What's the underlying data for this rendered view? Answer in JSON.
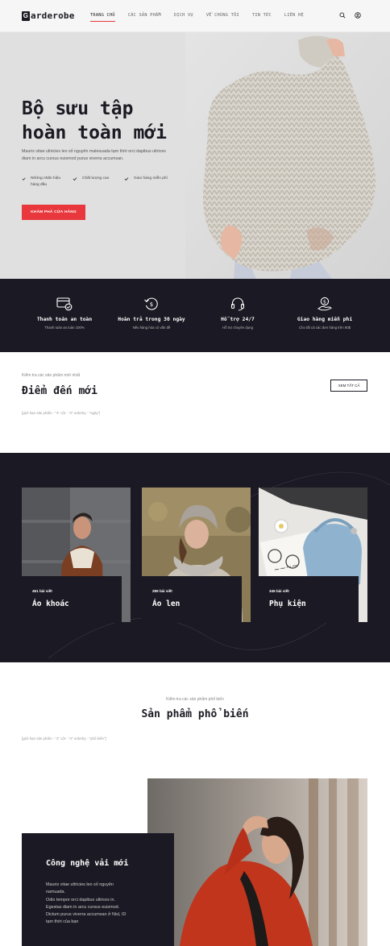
{
  "header": {
    "logo_letter": "G",
    "logo_text": "arderobe",
    "nav": [
      "TRANG CHỦ",
      "CÁC SẢN PHẨM",
      "DỊCH VỤ",
      "VỀ CHÚNG TÔI",
      "TIN TỨC",
      "LIÊN HỆ"
    ],
    "icons": [
      "search-icon",
      "user-icon"
    ],
    "accent_color": "#e8383d"
  },
  "hero": {
    "title_line1": "Bộ sưu tập",
    "title_line2": "hoàn toàn mới",
    "description": "Mauris vitae ultricies leo số nguyên malesuada tạm thời orci dapibus ultrices diam in arcu cursus euismod purus viverra accumsan.",
    "features": [
      "Những nhãn hiệu hàng đầu",
      "Chất lượng cao",
      "Giao hàng miễn phí"
    ],
    "button": "KHÁM PHÁ CỬA HÀNG"
  },
  "band": [
    {
      "title": "Thanh toán an toàn",
      "subtitle": "Thanh toán an toàn 100%",
      "icon": "card-check-icon"
    },
    {
      "title": "Hoàn trả trong 30 ngày",
      "subtitle": "Nếu hàng hóa có vấn đề",
      "icon": "return-icon"
    },
    {
      "title": "Hỗ trợ 24/7",
      "subtitle": "Hỗ trợ chuyên dụng",
      "icon": "headset-icon"
    },
    {
      "title": "Giao hàng miễn phí",
      "subtitle": "Cho tất cả các đơn hàng trên 80$",
      "icon": "hand-dollar-icon"
    }
  ],
  "new_arrivals": {
    "pretitle": "Kiểm tra các sản phẩm mới nhất",
    "title": "Điểm đến mới",
    "button": "XEM TẤT CẢ",
    "shortcode": "[giới hạn sản phẩm - \"4\" cột - \"4\" orderby - \"ngày\"]"
  },
  "categories": [
    {
      "count": "461 bài viết",
      "name": "Áo khoác"
    },
    {
      "count": "289 bài viết",
      "name": "Áo len"
    },
    {
      "count": "345 bài viết",
      "name": "Phụ kiện"
    }
  ],
  "popular": {
    "pretitle": "Kiểm tra các sản phẩm phổ biến",
    "title": "Sản phẩm phổ biến",
    "shortcode": "[giới hạn sản phẩm - \"4\" cột - \"4\" orderby - \"phổ biến\"]"
  },
  "promo": {
    "title": "Công nghệ vải mới",
    "lines": [
      "Mauris vitae ultricies leo số nguyên",
      "namuada.",
      "Odio tempor orci dapibus ultrices in.",
      "Egestas diam in arcu cursus euismod.",
      "Dictum purus viverra accumsan ở Nisl, ID",
      "tạm thời của bạn"
    ]
  }
}
